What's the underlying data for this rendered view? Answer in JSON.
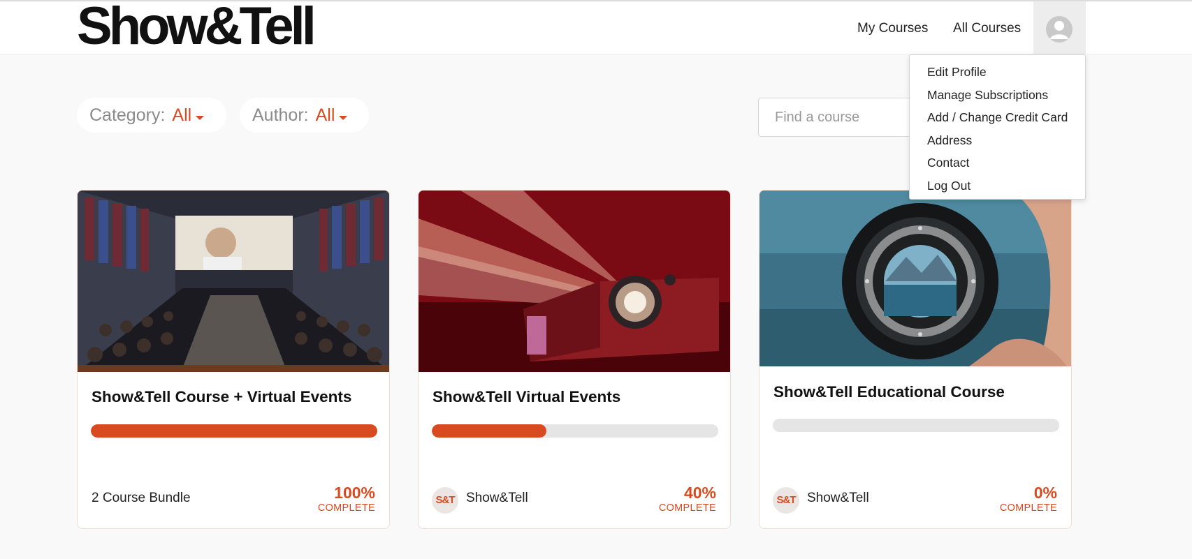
{
  "header": {
    "logo_text": "Show&Tell",
    "nav": {
      "my_courses": "My Courses",
      "all_courses": "All Courses"
    }
  },
  "user_menu": {
    "items": [
      "Edit Profile",
      "Manage Subscriptions",
      "Add / Change Credit Card",
      "Address",
      "Contact",
      "Log Out"
    ]
  },
  "filters": {
    "category_label": "Category:",
    "category_value": "All",
    "author_label": "Author:",
    "author_value": "All"
  },
  "search": {
    "placeholder": "Find a course",
    "value": ""
  },
  "colors": {
    "accent": "#d84b20",
    "progress_track": "#e5e5e5",
    "background": "#f9f9f9"
  },
  "courses": [
    {
      "title": "Show&Tell Course + Virtual Events",
      "progress": 100,
      "percent_text": "100%",
      "complete_label": "COMPLETE",
      "footer_text": "2 Course Bundle",
      "image": "cinema-audience"
    },
    {
      "title": "Show&Tell Virtual Events",
      "progress": 40,
      "percent_text": "40%",
      "complete_label": "COMPLETE",
      "author": {
        "avatar_text": "S&T",
        "name": "Show&Tell"
      },
      "image": "red-projector"
    },
    {
      "title": "Show&Tell Educational Course",
      "progress": 0,
      "percent_text": "0%",
      "complete_label": "COMPLETE",
      "author": {
        "avatar_text": "S&T",
        "name": "Show&Tell"
      },
      "image": "camera-lens-lake"
    }
  ]
}
